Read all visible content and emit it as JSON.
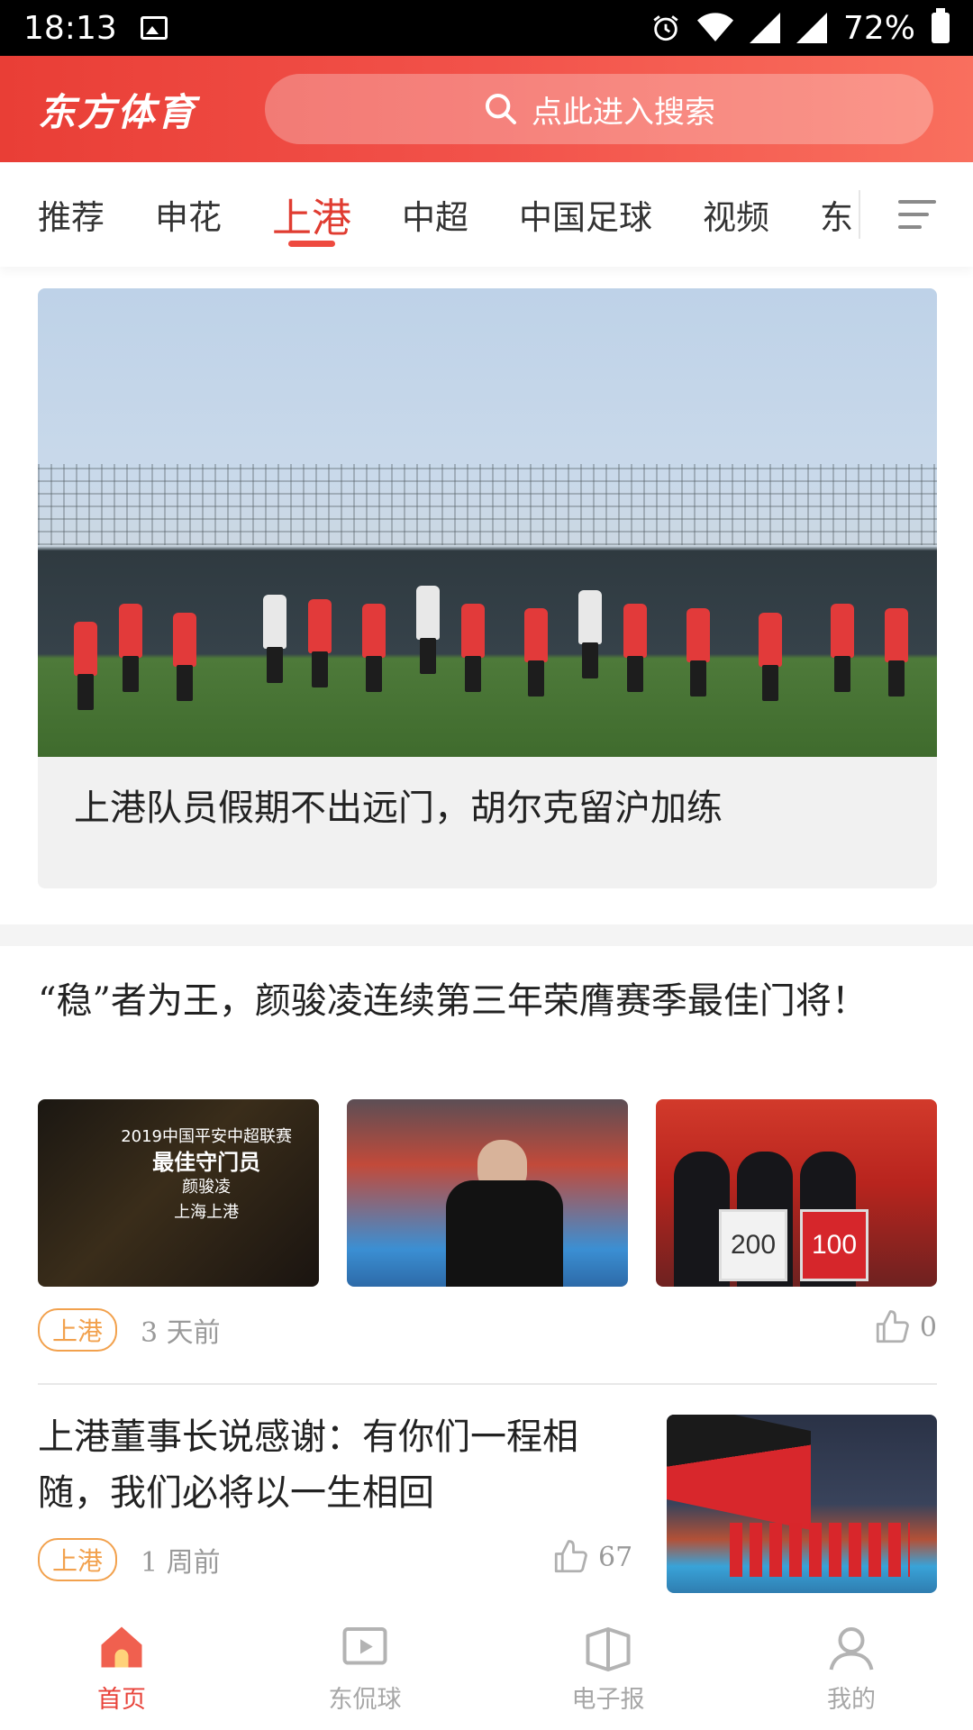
{
  "status_bar": {
    "time": "18:13",
    "battery": "72%"
  },
  "header": {
    "logo": "东方体育",
    "search_placeholder": "点此进入搜索"
  },
  "tabs": {
    "items": [
      "推荐",
      "申花",
      "上港",
      "中超",
      "中国足球",
      "视频",
      "东"
    ],
    "active": "上港"
  },
  "feature": {
    "title": "上港队员假期不出远门，胡尔克留沪加练"
  },
  "article1": {
    "title": "“稳”者为王，颜骏凌连续第三年荣膺赛季最佳门将！",
    "image1_text": [
      "2019中国平安中超联赛",
      "最佳守门员",
      "颜骏凌",
      "上海上港"
    ],
    "shirt_numbers": [
      "200",
      "100"
    ],
    "tag": "上港",
    "time": "3 天前",
    "likes": "0"
  },
  "article2": {
    "title": "上港董事长说感谢：有你们一程相随，我们必将以一生相回",
    "tag": "上港",
    "time": "1 周前",
    "likes": "67"
  },
  "bottom_nav": {
    "items": [
      {
        "label": "首页",
        "icon": "home-icon",
        "active": true
      },
      {
        "label": "东侃球",
        "icon": "play-icon",
        "active": false
      },
      {
        "label": "电子报",
        "icon": "newspaper-icon",
        "active": false
      },
      {
        "label": "我的",
        "icon": "user-icon",
        "active": false
      }
    ]
  },
  "colors": {
    "brand": "#ee4a3f",
    "tag": "#f2a14d",
    "muted": "#9a9a9a"
  }
}
